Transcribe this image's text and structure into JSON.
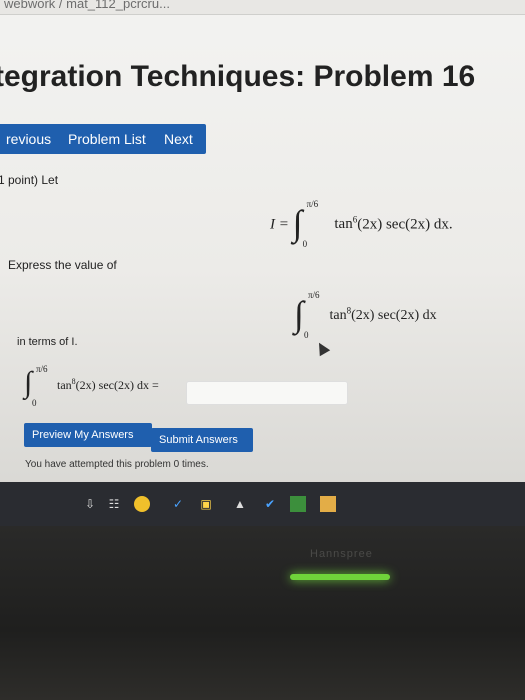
{
  "browser": {
    "url_fragment": "webwork / mat_112_pcrcru..."
  },
  "page": {
    "title": "tegration Techniques: Problem 16"
  },
  "nav": {
    "previous_label": "revious",
    "problem_list_label": "Problem List",
    "next_label": "Next"
  },
  "problem": {
    "points_label": "1 point) Let",
    "eq1": {
      "lhs": "I =",
      "upper": "π/6",
      "lower": "0",
      "integrand": "tan",
      "power": "6",
      "rest": "(2x) sec(2x) dx."
    },
    "express_label": "Express the value of",
    "eq2": {
      "upper": "π/6",
      "lower": "0",
      "integrand": "tan",
      "power": "8",
      "rest": "(2x) sec(2x) dx"
    },
    "terms_label": "in terms of I.",
    "eq3": {
      "upper": "π/6",
      "lower": "0",
      "integrand": "tan",
      "power": "8",
      "rest": "(2x) sec(2x) dx ="
    },
    "answer_value": ""
  },
  "actions": {
    "preview_label": "Preview My Answers",
    "submit_label": "Submit Answers"
  },
  "status": {
    "attempts_text": "You have attempted this problem 0 times."
  },
  "taskbar": {
    "icons": [
      "pin-icon",
      "files-icon",
      "chrome-icon",
      "weather-icon",
      "lock-icon",
      "camera-icon",
      "checkmark-icon",
      "store-icon",
      "notes-icon"
    ]
  },
  "monitor": {
    "brand": "Hannspree"
  }
}
